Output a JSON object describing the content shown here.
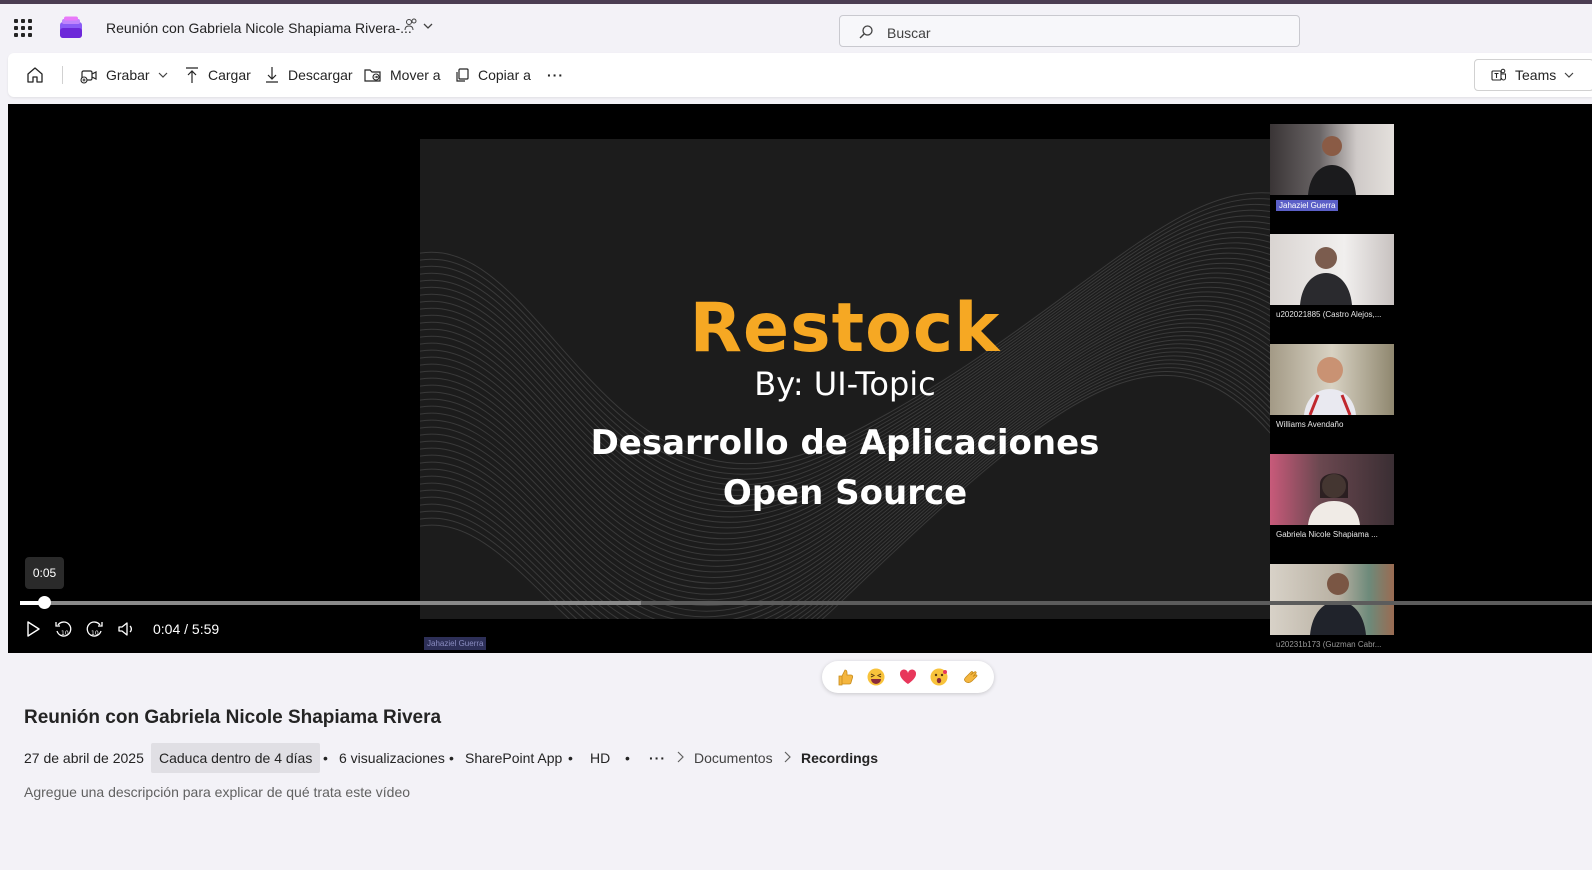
{
  "app": {
    "title": "Reunión con Gabriela Nicole Shapiama Rivera-...",
    "search_placeholder": "Buscar"
  },
  "toolbar": {
    "record": "Grabar",
    "upload": "Cargar",
    "download": "Descargar",
    "move": "Mover a",
    "copy": "Copiar a",
    "more": "···",
    "teams": "Teams"
  },
  "slide": {
    "title": "Restock",
    "subtitle": "By: UI-Topic",
    "line1": "Desarrollo de Aplicaciones",
    "line2": "Open Source",
    "presenter": "Jahaziel Guerra",
    "title_color": "#f6a823"
  },
  "participants": [
    {
      "name": "Jahaziel Guerra"
    },
    {
      "name": "u202021885 (Castro Alejos,..."
    },
    {
      "name": "Williams Avendaño"
    },
    {
      "name": "Gabriela Nicole Shapiama ..."
    },
    {
      "name": "u20231b173 (Guzman Cabr..."
    }
  ],
  "player": {
    "hover_time": "0:05",
    "timecode": "0:04 / 5:59",
    "progress": 0.012,
    "buffered": 0.395
  },
  "reactions": [
    "like-icon",
    "laugh-icon",
    "heart-icon",
    "surprised-icon",
    "applause-icon"
  ],
  "video": {
    "title": "Reunión con Gabriela Nicole Shapiama Rivera",
    "date": "27 de abril de 2025",
    "expires": "Caduca dentro de 4 días",
    "views": "6 visualizaciones",
    "source": "SharePoint App",
    "quality": "HD",
    "more": "···",
    "crumb1": "Documentos",
    "crumb2": "Recordings",
    "description_placeholder": "Agregue una descripción para explicar de qué trata este vídeo"
  }
}
